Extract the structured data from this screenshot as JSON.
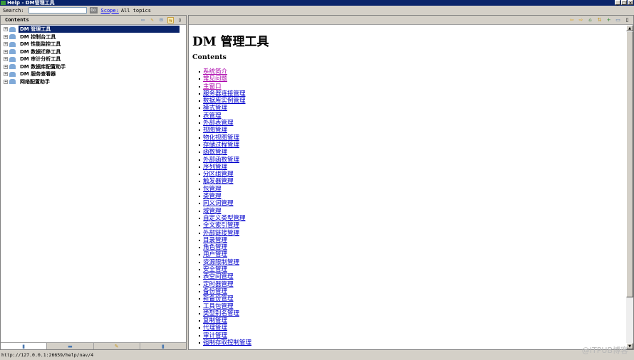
{
  "window": {
    "title": "Help - DM管理工具",
    "controls": [
      "_",
      "□",
      "×"
    ]
  },
  "search": {
    "label": "Search:",
    "value": "",
    "go_label": "Go",
    "scope_link": "Scope:",
    "scope_value": "All topics"
  },
  "left_panel": {
    "title": "Contents",
    "tools": [
      "print-icon",
      "link-icon",
      "collapse-icon",
      "sync-icon",
      "maximize-icon"
    ],
    "tree": [
      {
        "label": "DM 管理工具",
        "selected": true
      },
      {
        "label": "DM 控制台工具"
      },
      {
        "label": "DM 性能监控工具"
      },
      {
        "label": "DM 数据迁移工具"
      },
      {
        "label": "DM 审计分析工具"
      },
      {
        "label": "DM 数据库配置助手"
      },
      {
        "label": "DM 服务查看器"
      },
      {
        "label": "网络配置助手"
      }
    ]
  },
  "right_panel": {
    "page_title": "DM 管理工具",
    "contents_heading": "Contents",
    "links": [
      {
        "label": "系统简介",
        "visited": true
      },
      {
        "label": "常见问题",
        "visited": true
      },
      {
        "label": "主窗口",
        "visited": true
      },
      {
        "label": "服务器连接管理"
      },
      {
        "label": "数据库实例管理"
      },
      {
        "label": "模式管理"
      },
      {
        "label": "表管理"
      },
      {
        "label": "外部表管理"
      },
      {
        "label": "视图管理"
      },
      {
        "label": "物化视图管理"
      },
      {
        "label": "存储过程管理"
      },
      {
        "label": "函数管理"
      },
      {
        "label": "外部函数管理"
      },
      {
        "label": "序列管理"
      },
      {
        "label": "分区组管理"
      },
      {
        "label": "触发器管理"
      },
      {
        "label": "包管理"
      },
      {
        "label": "类管理"
      },
      {
        "label": "同义词管理"
      },
      {
        "label": "域管理"
      },
      {
        "label": "自定义类型管理"
      },
      {
        "label": "全文索引管理"
      },
      {
        "label": "外部链接管理"
      },
      {
        "label": "目录管理"
      },
      {
        "label": "角色管理"
      },
      {
        "label": "用户管理"
      },
      {
        "label": "资源限制管理"
      },
      {
        "label": "安全管理"
      },
      {
        "label": "表空间管理"
      },
      {
        "label": "定时器管理"
      },
      {
        "label": "备份管理"
      },
      {
        "label": "新备份管理"
      },
      {
        "label": "工具包管理"
      },
      {
        "label": "类型别名管理"
      },
      {
        "label": "复制管理"
      },
      {
        "label": "代理管理"
      },
      {
        "label": "审计管理"
      },
      {
        "label": "强制存取控制管理"
      }
    ]
  },
  "status": {
    "url": "http://127.0.0.1:26659/help/nav/4"
  },
  "watermark": "@ITPUB博客"
}
